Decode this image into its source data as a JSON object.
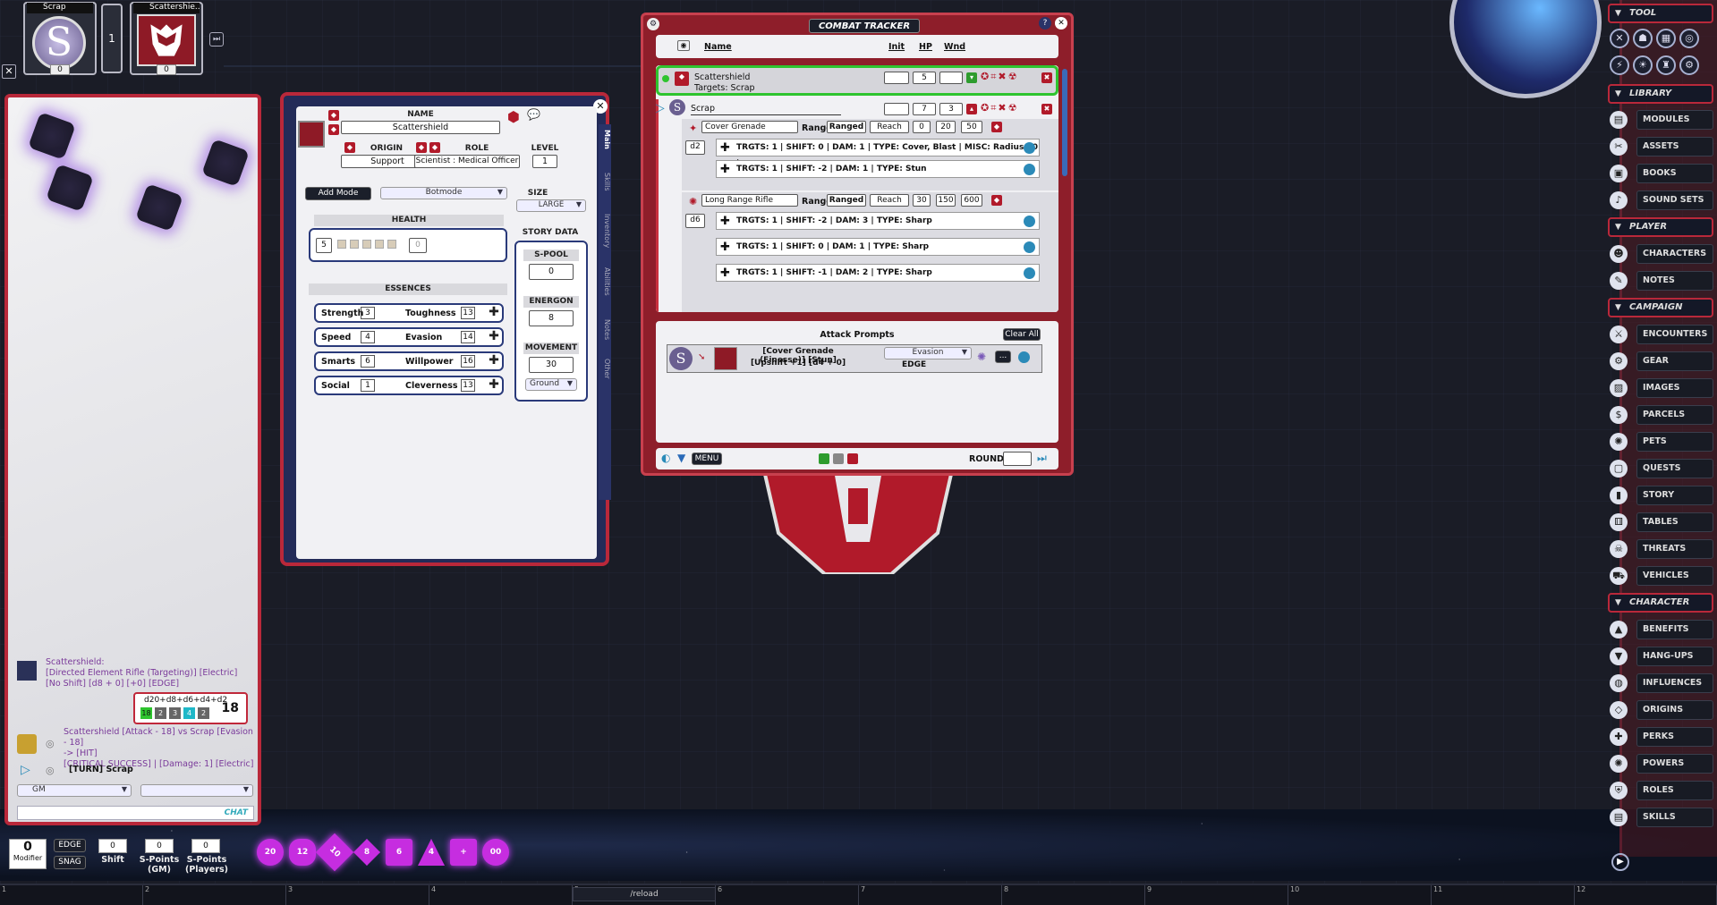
{
  "portraits": [
    {
      "name": "Scrap",
      "count": "0",
      "initial": "S"
    },
    {
      "name": "Scattershie...",
      "count": "0"
    }
  ],
  "turn_indicator": "1",
  "chat": {
    "messages": [
      {
        "line1": "Scattershield:",
        "line2": "[Directed Element Rifle (Targeting)] [Electric]",
        "line3": "[No Shift] [d8 + 0] [+0] [EDGE]"
      },
      {
        "formula": "d20+d8+d6+d4+d2",
        "total": "18",
        "dice": [
          "18",
          "2",
          "3",
          "4",
          "2"
        ]
      },
      {
        "line1": "Scattershield [Attack - 18] vs Scrap [Evasion - 18]",
        "line2": "-> [HIT]",
        "line3": "[CRITICAL SUCCESS] | [Damage: 1] [Electric]"
      },
      {
        "line1": "[TURN] Scrap"
      }
    ],
    "identity": "GM",
    "language": "",
    "send_label": "CHAT",
    "float_dice": [
      "",
      "",
      "",
      ""
    ]
  },
  "sheet": {
    "name_label": "NAME",
    "name": "Scattershield",
    "origin_label": "ORIGIN",
    "origin": "Support",
    "role_label": "ROLE",
    "role": "Scientist : Medical Officer",
    "level_label": "LEVEL",
    "level": "1",
    "add_mode": "Add Mode",
    "mode": "Botmode",
    "size_label": "SIZE",
    "size": "LARGE",
    "health_label": "HEALTH",
    "health_max": "5",
    "health_cur": "0",
    "story_label": "STORY DATA",
    "spool_label": "S-POOL",
    "spool": "0",
    "energon_label": "ENERGON",
    "energon": "8",
    "movement_label": "MOVEMENT",
    "movement": "30",
    "movement_mode": "Ground",
    "essences_label": "ESSENCES",
    "essences": [
      {
        "a": "Strength",
        "av": "3",
        "b": "Toughness",
        "bv": "13"
      },
      {
        "a": "Speed",
        "av": "4",
        "b": "Evasion",
        "bv": "14"
      },
      {
        "a": "Smarts",
        "av": "6",
        "b": "Willpower",
        "bv": "16"
      },
      {
        "a": "Social",
        "av": "1",
        "b": "Cleverness",
        "bv": "13"
      }
    ],
    "tabs": [
      "Main",
      "Skills",
      "Inventory",
      "Abilities",
      "Notes",
      "Other"
    ]
  },
  "combat": {
    "title": "COMBAT TRACKER",
    "headers": {
      "name": "Name",
      "init": "Init",
      "hp": "HP",
      "wnd": "Wnd"
    },
    "entries": [
      {
        "name": "Scattershield",
        "targets": "Targets: Scrap",
        "init": "",
        "hp": "5",
        "wnd": ""
      },
      {
        "name": "Scrap",
        "init": "",
        "hp": "7",
        "wnd": "3"
      }
    ],
    "weapons": [
      {
        "name": "Cover Grenade",
        "range_label": "Range",
        "range": "Ranged",
        "reach_label": "Reach",
        "r1": "0",
        "r2": "20",
        "r3": "50",
        "die": "d2",
        "attacks": [
          "TRGTS: 1 | SHIFT: 0 | DAM: 1 | TYPE: Cover, Blast | MISC: Radius 20 |",
          "TRGTS: 1 | SHIFT: -2 | DAM: 1 | TYPE: Stun"
        ]
      },
      {
        "name": "Long Range Rifle",
        "range_label": "Range",
        "range": "Ranged",
        "reach_label": "Reach",
        "r1": "30",
        "r2": "150",
        "r3": "600",
        "die": "d6",
        "attacks": [
          "TRGTS: 1 | SHIFT: -2 | DAM: 3 | TYPE: Sharp",
          "TRGTS: 1 | SHIFT: 0 | DAM: 1 | TYPE: Sharp",
          "TRGTS: 1 | SHIFT: -1 | DAM: 2 | TYPE: Sharp"
        ]
      }
    ],
    "prompts_label": "Attack Prompts",
    "clear_all": "Clear All",
    "prompt": {
      "line1": "[Cover Grenade (Finesse)] [Stun]",
      "line2": "[Upshift +1] [d4 + 0]",
      "defense": "Evasion",
      "edge": "EDGE",
      "more": "..."
    },
    "menu": "MENU",
    "round_label": "ROUND",
    "round": ""
  },
  "sidebar": {
    "sections": [
      {
        "title": "TOOL"
      },
      {
        "title": "LIBRARY",
        "items": [
          "MODULES",
          "ASSETS",
          "BOOKS",
          "SOUND SETS"
        ]
      },
      {
        "title": "PLAYER",
        "items": [
          "CHARACTERS",
          "NOTES"
        ]
      },
      {
        "title": "CAMPAIGN",
        "items": [
          "ENCOUNTERS",
          "GEAR",
          "IMAGES",
          "PARCELS",
          "PETS",
          "QUESTS",
          "STORY",
          "TABLES",
          "THREATS",
          "VEHICLES"
        ]
      },
      {
        "title": "CHARACTER",
        "items": [
          "BENEFITS",
          "HANG-UPS",
          "INFLUENCES",
          "ORIGINS",
          "PERKS",
          "POWERS",
          "ROLES",
          "SKILLS"
        ]
      }
    ]
  },
  "bottom": {
    "modifier_value": "0",
    "modifier_label": "Modifier",
    "edge": "EDGE",
    "snag": "SNAG",
    "shift_value": "0",
    "shift_label": "Shift",
    "spgm_value": "0",
    "spgm_label": "S-Points (GM)",
    "spp_value": "0",
    "spp_label": "S-Points (Players)",
    "dice": [
      "20",
      "12",
      "10",
      "8",
      "6",
      "4",
      "+",
      "00"
    ]
  },
  "hotbar": {
    "slots": [
      "1",
      "2",
      "3",
      "4",
      "5",
      "6",
      "7",
      "8",
      "9",
      "10",
      "11",
      "12"
    ],
    "command": "/reload"
  },
  "colors": {
    "accent": "#b9283a",
    "panel": "#f1f1f4",
    "navy": "#232b58",
    "bg": "#1a1c26"
  }
}
